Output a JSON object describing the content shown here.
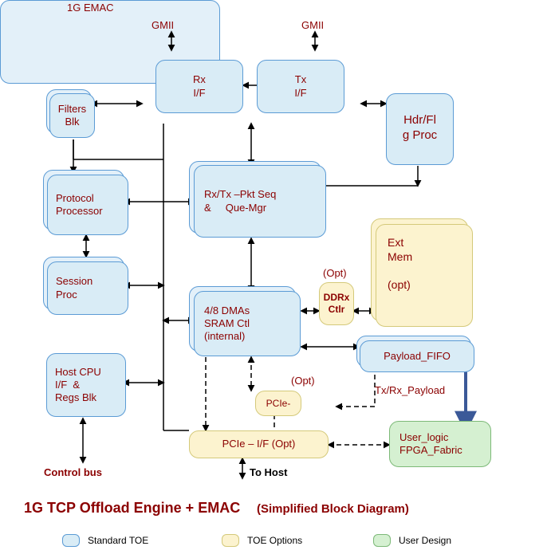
{
  "labels": {
    "gmii_left": "GMII",
    "gmii_right": "GMII",
    "emac_title": "1G EMAC",
    "opt1": "(Opt)",
    "opt2": "(Opt)",
    "txrx_payload": "Tx/Rx_Payload",
    "control_bus": "Control bus",
    "to_host": "To Host"
  },
  "blocks": {
    "rx_if": "Rx\nI/F",
    "tx_if": "Tx\nI/F",
    "filters": "Filters\nBlk",
    "hdr_flg": "Hdr/Fl\ng Proc",
    "proto_proc": "Protocol\nProcessor",
    "pkt_seq": "Rx/Tx –Pkt Seq\n&     Que-Mgr",
    "session": "Session\nProc",
    "ddrx": "DDRx\nCtlr",
    "ext_mem": "Ext\nMem\n\n(opt)",
    "dmas": "4/8 DMAs\nSRAM Ctl\n(internal)",
    "host_cpu": "Host CPU\nI/F  &\nRegs Blk",
    "payload_fifo": "Payload_FIFO",
    "pcie_small": "PCIe-",
    "pcie_if": "PCIe – I/F     (Opt)",
    "user_logic": "User_logic\nFPGA_Fabric"
  },
  "title": {
    "main": "1G TCP Offload Engine + EMAC",
    "sub": "(Simplified Block Diagram)"
  },
  "legend": {
    "std": "Standard TOE",
    "opt": "TOE Options",
    "user": "User Design"
  }
}
